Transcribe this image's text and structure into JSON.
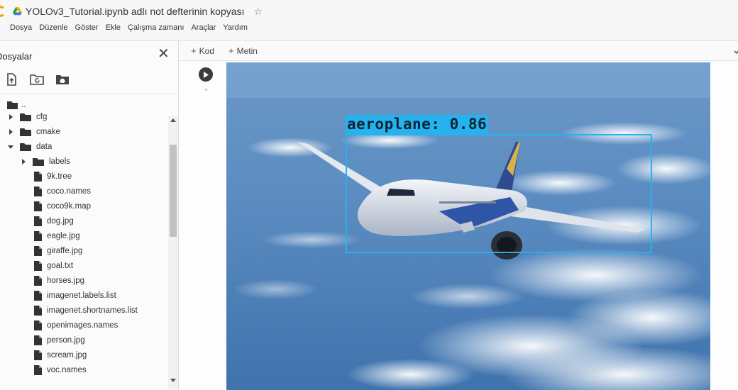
{
  "notebook": {
    "title": "YOLOv3_Tutorial.ipynb adlı not defterinin kopyası"
  },
  "menu": [
    "Dosya",
    "Düzenle",
    "Göster",
    "Ekle",
    "Çalışma zamanı",
    "Araçlar",
    "Yardım"
  ],
  "sidebar": {
    "title": "Dosyalar",
    "tree": [
      {
        "label": "..",
        "kind": "parent-folder"
      },
      {
        "label": "cfg",
        "kind": "folder",
        "expanded": false
      },
      {
        "label": "cmake",
        "kind": "folder",
        "expanded": false
      },
      {
        "label": "data",
        "kind": "folder",
        "expanded": true
      },
      {
        "label": "labels",
        "kind": "folder",
        "expanded": false
      },
      {
        "label": "9k.tree",
        "kind": "file"
      },
      {
        "label": "coco.names",
        "kind": "file"
      },
      {
        "label": "coco9k.map",
        "kind": "file"
      },
      {
        "label": "dog.jpg",
        "kind": "file"
      },
      {
        "label": "eagle.jpg",
        "kind": "file"
      },
      {
        "label": "giraffe.jpg",
        "kind": "file"
      },
      {
        "label": "goal.txt",
        "kind": "file"
      },
      {
        "label": "horses.jpg",
        "kind": "file"
      },
      {
        "label": "imagenet.labels.list",
        "kind": "file"
      },
      {
        "label": "imagenet.shortnames.list",
        "kind": "file"
      },
      {
        "label": "openimages.names",
        "kind": "file"
      },
      {
        "label": "person.jpg",
        "kind": "file"
      },
      {
        "label": "scream.jpg",
        "kind": "file"
      },
      {
        "label": "voc.names",
        "kind": "file"
      }
    ]
  },
  "toolbar": {
    "code_label": "Kod",
    "text_label": "Metin"
  },
  "output": {
    "detection_label": "aeroplane: 0.86"
  },
  "colors": {
    "detection": "#25b3ef",
    "sky_top": "#6a98c7",
    "sky_bottom": "#3f73ad"
  }
}
